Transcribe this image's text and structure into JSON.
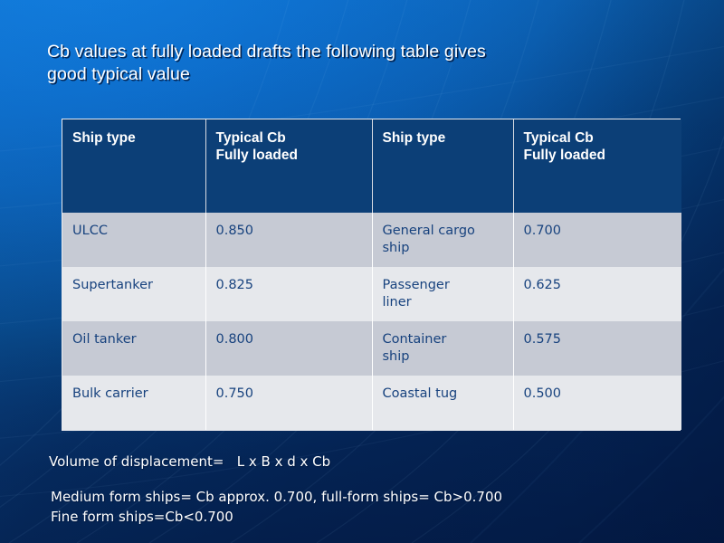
{
  "slide": {
    "title": "Cb values at fully loaded drafts the following table gives\ngood typical value",
    "background": {
      "color_top_left": "#0f76d8",
      "color_bottom_right": "#052a5c"
    }
  },
  "table": {
    "header_bg": "#0c3f77",
    "header_text_color": "#ffffff",
    "row_band_dark": "#c6cad4",
    "row_band_light": "#e6e8ec",
    "cell_text_color": "#17427e",
    "columns": [
      "Ship type",
      "Typical Cb\nFully loaded",
      "Ship type",
      "Typical Cb\nFully loaded"
    ],
    "rows": [
      [
        "ULCC",
        "0.850",
        "General cargo\nship",
        "0.700"
      ],
      [
        "Supertanker",
        "0.825",
        "Passenger\nliner",
        "0.625"
      ],
      [
        "Oil tanker",
        "0.800",
        "Container\nship",
        "0.575"
      ],
      [
        "Bulk carrier",
        "0.750",
        "Coastal tug",
        "0.500"
      ]
    ]
  },
  "notes": {
    "formula": "Volume of displacement=   L x B x d x Cb",
    "classification": "Medium form ships= Cb approx. 0.700, full-form ships= Cb>0.700\nFine form ships=Cb<0.700"
  }
}
